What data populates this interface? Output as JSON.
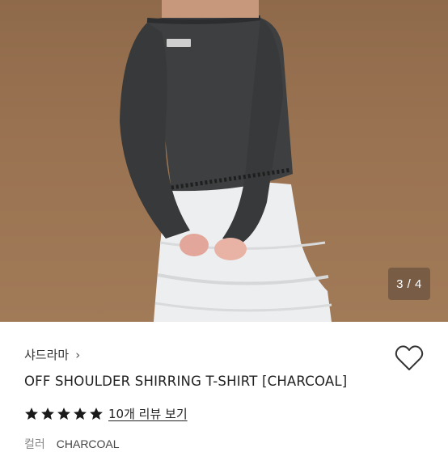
{
  "gallery": {
    "counter": "3 / 4"
  },
  "product": {
    "brand": "샤드라마",
    "brand_chevron": "›",
    "title": "OFF SHOULDER SHIRRING T-SHIRT [CHARCOAL]",
    "rating_stars": 5,
    "review_link": "10개 리뷰 보기",
    "option_label": "컬러",
    "option_value": "CHARCOAL"
  },
  "colors": {
    "background": "#9a7352",
    "shirt": "#3d3f40",
    "skirt": "#eef0f1",
    "star": "#1a1a1a"
  },
  "icons": {
    "wishlist": "heart-outline-icon",
    "rating": "star-icon",
    "brand_link": "chevron-right-icon"
  }
}
